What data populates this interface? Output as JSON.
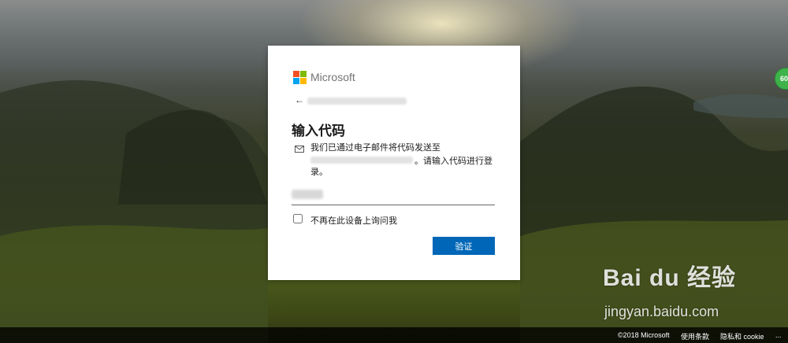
{
  "brand": {
    "name": "Microsoft",
    "logo_colors": [
      "#f25022",
      "#7fba00",
      "#00a4ef",
      "#ffb900"
    ]
  },
  "dialog": {
    "back_icon": "arrow-left-icon",
    "title": "输入代码",
    "message_icon": "mail-icon",
    "message_line1": "我们已通过电子邮件将代码发送至",
    "message_tail": "。请输入代码进行登",
    "message_tail2": "录。",
    "code_input": {
      "value": "",
      "placeholder": ""
    },
    "checkbox_label": "不再在此设备上询问我",
    "verify_button": "验证",
    "accent_color": "#0067b8"
  },
  "footer": {
    "copyright": "©2018 Microsoft",
    "terms": "使用条款",
    "privacy": "隐私和 cookie",
    "more": "..."
  },
  "overlay": {
    "badge_text": "60",
    "watermark_logo": "Bai du 经验",
    "watermark_url": "jingyan.baidu.com"
  }
}
